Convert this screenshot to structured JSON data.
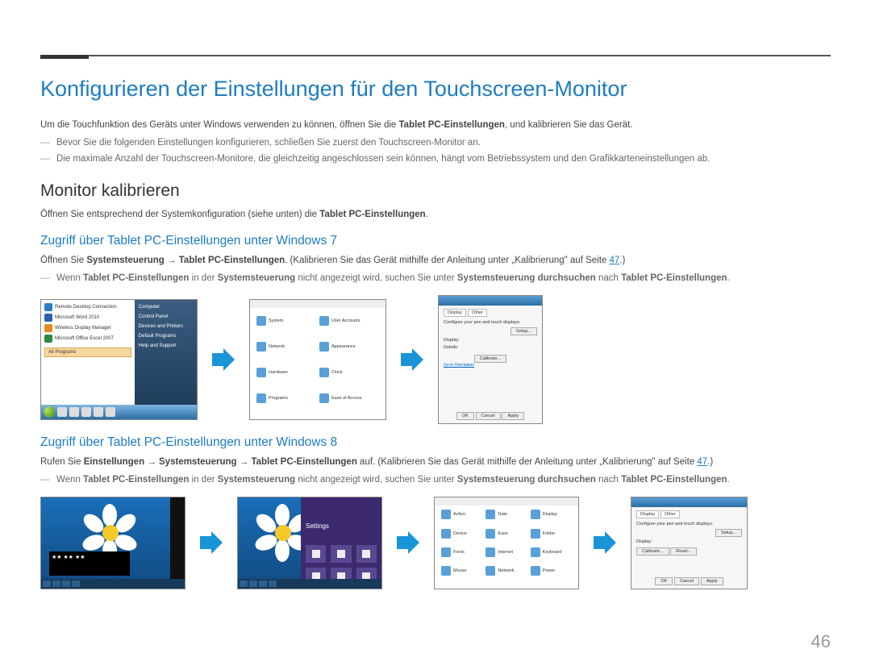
{
  "page_number": "46",
  "title": "Konfigurieren der Einstellungen für den Touchscreen-Monitor",
  "intro": {
    "pre": "Um die Touchfunktion des Geräts unter Windows verwenden zu können, öffnen Sie die ",
    "bold": "Tablet PC-Einstellungen",
    "post": ", und kalibrieren Sie das Gerät."
  },
  "intro_notes": [
    "Bevor Sie die folgenden Einstellungen konfigurieren, schließen Sie zuerst den Touchscreen-Monitor an.",
    "Die maximale Anzahl der Touchscreen-Monitore, die gleichzeitig angeschlossen sein können, hängt vom Betriebssystem und den Grafikkarteneinstellungen ab."
  ],
  "sub_heading": "Monitor kalibrieren",
  "sub_intro": {
    "pre": "Öffnen Sie entsprechend der Systemkonfiguration (siehe unten) die ",
    "bold": "Tablet PC-Einstellungen",
    "post": "."
  },
  "win7": {
    "heading": "Zugriff über Tablet PC-Einstellungen unter Windows 7",
    "line_pre": "Öffnen Sie ",
    "cp": "Systemsteuerung",
    "arrow": "→",
    "tpc": "Tablet PC-Einstellungen",
    "line_post": ". (Kalibrieren Sie das Gerät mithilfe der Anleitung unter „Kalibrierung\" auf Seite ",
    "page_ref": "47",
    "post2": ".)",
    "note": {
      "a": "Wenn ",
      "b": "Tablet PC-Einstellungen",
      "c": " in der ",
      "d": "Systemsteuerung",
      "e": " nicht angezeigt wird, suchen Sie unter ",
      "f": "Systemsteuerung durchsuchen",
      "g": " nach ",
      "h": "Tablet PC-Einstellungen",
      "i": "."
    }
  },
  "win8": {
    "heading": "Zugriff über Tablet PC-Einstellungen unter Windows 8",
    "line_pre": "Rufen Sie ",
    "s1": "Einstellungen",
    "s2": "Systemsteuerung",
    "s3": "Tablet PC-Einstellungen",
    "line_post": " auf. (Kalibrieren Sie das Gerät mithilfe der Anleitung unter „Kalibrierung\" auf Seite ",
    "page_ref": "47",
    "post2": ".)",
    "note": {
      "a": "Wenn ",
      "b": "Tablet PC-Einstellungen",
      "c": " in der ",
      "d": "Systemsteuerung",
      "e": " nicht angezeigt wird, suchen Sie unter ",
      "f": "Systemsteuerung durchsuchen",
      "g": " nach ",
      "h": "Tablet PC-Einstellungen",
      "i": "."
    }
  },
  "mock": {
    "start_items": [
      "Remote Desktop Connection",
      "Microsoft Word 2010",
      "Wireless Display Manager",
      "Microsoft Office Excel 2007"
    ],
    "all_programs": "All Programs",
    "start_right": [
      "Computer",
      "Control Panel",
      "Devices and Printers",
      "Default Programs",
      "Help and Support"
    ],
    "dlg_tabs": [
      "Display",
      "Other"
    ],
    "dlg_txt": "Configure your pen and touch displays.",
    "dlg_setup": "Setup...",
    "dlg_calibrate": "Calibrate...",
    "dlg_reset": "Reset...",
    "dlg_display": "Display:",
    "dlg_details": "Details:",
    "dlg_link": "Go to Orientation",
    "dlg_ok": "OK",
    "dlg_cancel": "Cancel",
    "dlg_apply": "Apply",
    "win8_settings": "Settings",
    "stars": "★★ ★★ ★★"
  }
}
